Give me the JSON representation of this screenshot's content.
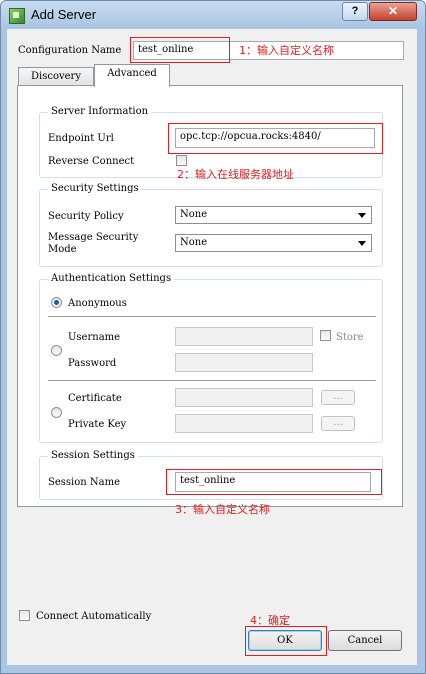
{
  "window": {
    "title": "Add Server",
    "help_label": "?",
    "close_label": "✕"
  },
  "config": {
    "label": "Configuration Name",
    "value": "test_online",
    "note": "1：输入自定义名称"
  },
  "tabs": [
    {
      "label": "Discovery"
    },
    {
      "label": "Advanced"
    }
  ],
  "server_info": {
    "title": "Server Information",
    "endpoint_label": "Endpoint Url",
    "endpoint_value": "opc.tcp://opcua.rocks:4840/",
    "reverse_label": "Reverse Connect",
    "note": "2：输入在线服务器地址"
  },
  "security": {
    "title": "Security Settings",
    "policy_label": "Security Policy",
    "policy_value": "None",
    "mode_label_1": "Message Security",
    "mode_label_2": "Mode",
    "mode_value": "None"
  },
  "auth": {
    "title": "Authentication Settings",
    "anonymous_label": "Anonymous",
    "username_label": "Username",
    "password_label": "Password",
    "store_label": "Store",
    "certificate_label": "Certificate",
    "private_key_label": "Private Key",
    "browse_label": "..."
  },
  "session": {
    "title": "Session Settings",
    "name_label": "Session Name",
    "name_value": "test_online",
    "note": "3：输入自定义名称"
  },
  "footer": {
    "connect_auto_label": "Connect Automatically",
    "ok_label": "OK",
    "cancel_label": "Cancel",
    "note": "4：确定"
  },
  "colors": {
    "annotation": "#e02020",
    "titlebar": "#b9d1ea",
    "close": "#c5412d"
  }
}
